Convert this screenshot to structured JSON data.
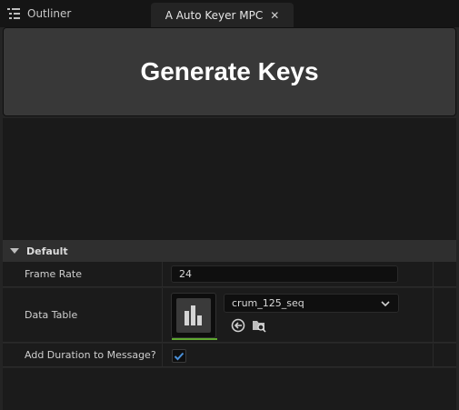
{
  "tabs": {
    "outliner_label": "Outliner",
    "active_label": "A Auto Keyer MPC",
    "close_glyph": "✕"
  },
  "panel": {
    "generate_button_label": "Generate Keys"
  },
  "section": {
    "title": "Default"
  },
  "properties": {
    "frame_rate": {
      "label": "Frame Rate",
      "value": "24"
    },
    "data_table": {
      "label": "Data Table",
      "selected": "crum_125_seq"
    },
    "add_duration": {
      "label": "Add Duration to Message?",
      "checked": true
    }
  },
  "colors": {
    "accent_green": "#5fa830",
    "checkbox_blue": "#4a90d9"
  }
}
